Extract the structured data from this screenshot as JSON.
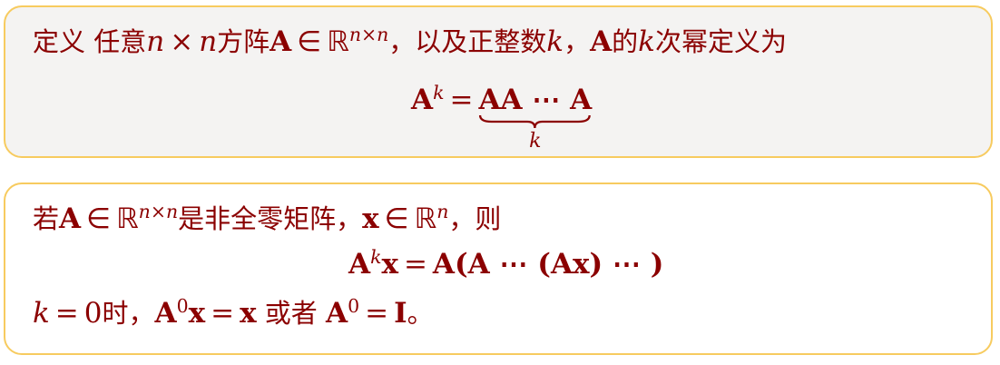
{
  "box1": {
    "line1": {
      "label_def": "定义",
      "text_any": " 任意",
      "n": "n",
      "times": "×",
      "text_square": "方阵",
      "A": "A",
      "in": "∈",
      "R": "ℝ",
      "sup_nxn": "n×n",
      "text_and": "，以及正整数",
      "k": "k",
      "comma": "，",
      "text_power": "的",
      "text_power_def": "次幂定义为"
    },
    "formula": {
      "A": "A",
      "sup_k": "k",
      "eq": "=",
      "product": "AA ⋯ A",
      "brace_label": "k"
    }
  },
  "box2": {
    "line1": {
      "text_if": "若",
      "A": "A",
      "in": "∈",
      "R": "ℝ",
      "sup_nxn": "n×n",
      "text_nonzero": "是非全零矩阵，",
      "x": "x",
      "in2": "∈",
      "R2": "ℝ",
      "sup_n": "n",
      "text_then": "，则"
    },
    "formula": {
      "A": "A",
      "sup_k": "k",
      "x": "x",
      "eq": "=",
      "rhs": "A(A ⋯ (Ax) ⋯ )"
    },
    "line3": {
      "k": "k",
      "eq": "=",
      "zero": "0",
      "text_when": "时，",
      "A0": "A",
      "sup_0": "0",
      "x": "x",
      "eq2": "=",
      "x2": "x",
      "text_or": " 或者 ",
      "A0b": "A",
      "sup_0b": "0",
      "eq3": "=",
      "I": "I",
      "period": "。"
    }
  },
  "colors": {
    "text": "#8B0000",
    "border": "#F7CB5F",
    "box1_bg": "#F4F3F2",
    "box2_bg": "#FFFFFF"
  }
}
